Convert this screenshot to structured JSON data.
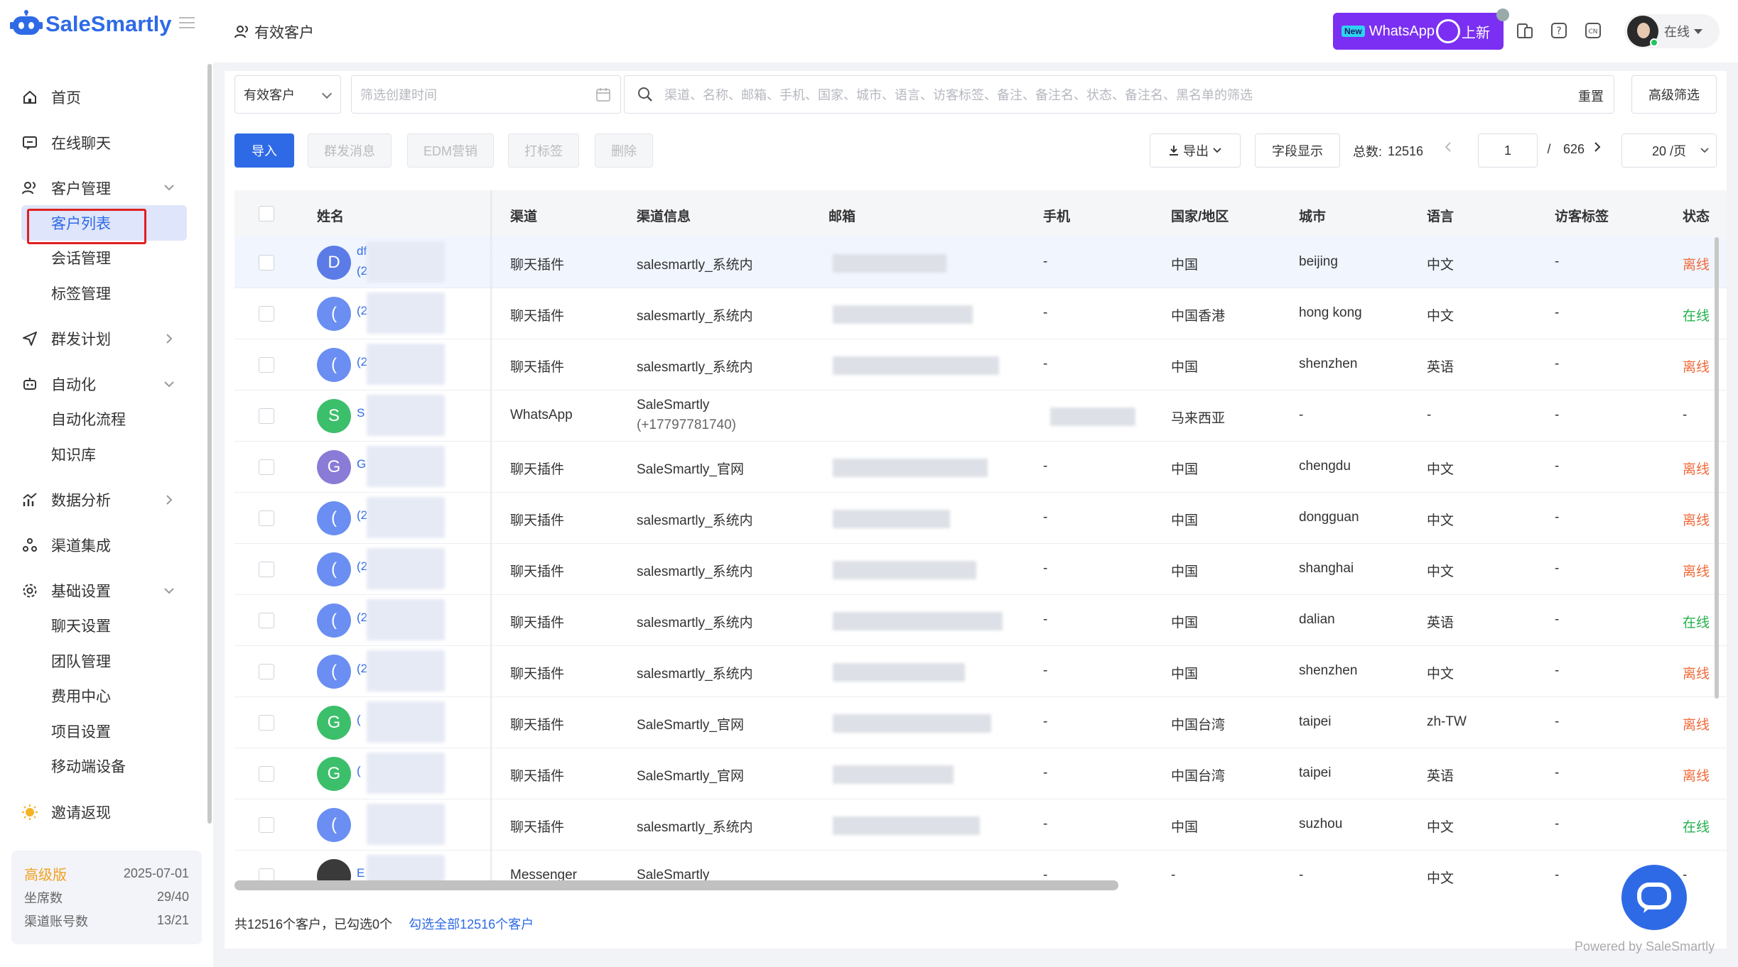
{
  "brand": {
    "name": "SaleSmartly"
  },
  "nav": {
    "home": "首页",
    "chat": "在线聊天",
    "customer_mgmt": "客户管理",
    "customer_list": "客户列表",
    "session_mgmt": "会话管理",
    "tag_mgmt": "标签管理",
    "broadcast": "群发计划",
    "automation": "自动化",
    "automation_flow": "自动化流程",
    "knowledge": "知识库",
    "analytics": "数据分析",
    "channels": "渠道集成",
    "basic_settings": "基础设置",
    "chat_settings": "聊天设置",
    "team_mgmt": "团队管理",
    "billing": "费用中心",
    "project_settings": "项目设置",
    "mobile_devices": "移动端设备",
    "invite": "邀请返现"
  },
  "plan": {
    "name": "高级版",
    "expiry": "2025-07-01",
    "seats_label": "坐席数",
    "seats_value": "29/40",
    "channels_label": "渠道账号数",
    "channels_value": "13/21"
  },
  "header": {
    "title": "有效客户",
    "banner_new": "New",
    "banner_text": "WhatsApp",
    "banner_suffix": "上新",
    "user_status": "在线",
    "cn_icon": "CN"
  },
  "filters": {
    "customer_type": "有效客户",
    "date_placeholder": "筛选创建时间",
    "search_placeholder": "渠道、名称、邮箱、手机、国家、城市、语言、访客标签、备注、备注名、状态、备注名、黑名单的筛选",
    "reset": "重置",
    "advanced": "高级筛选"
  },
  "toolbar": {
    "import": "导入",
    "broadcast": "群发消息",
    "edm": "EDM营销",
    "tag": "打标签",
    "delete": "删除",
    "export": "导出",
    "fields": "字段显示",
    "total_label": "总数:",
    "total": "12516",
    "page": "1",
    "slash": "/",
    "pages": "626",
    "page_size": "20 /页"
  },
  "table": {
    "headers": {
      "name": "姓名",
      "channel": "渠道",
      "channel_info": "渠道信息",
      "email": "邮箱",
      "phone": "手机",
      "country": "国家/地区",
      "city": "城市",
      "language": "语言",
      "visitor_tags": "访客标签",
      "status": "状态"
    },
    "rows": [
      {
        "initial": "D",
        "name": "df",
        "name2": "(2",
        "channel": "聊天插件",
        "info": "salesmartly_系统内",
        "info2": "",
        "phone": "-",
        "country": "中国",
        "city": "beijing",
        "lang": "中文",
        "tags": "-",
        "status": "离线"
      },
      {
        "initial": "(",
        "name": "(2",
        "name2": "",
        "channel": "聊天插件",
        "info": "salesmartly_系统内",
        "info2": "",
        "phone": "-",
        "country": "中国香港",
        "city": "hong kong",
        "lang": "中文",
        "tags": "-",
        "status": "在线"
      },
      {
        "initial": "(",
        "name": "(2",
        "name2": "",
        "channel": "聊天插件",
        "info": "salesmartly_系统内",
        "info2": "",
        "phone": "-",
        "country": "中国",
        "city": "shenzhen",
        "lang": "英语",
        "tags": "-",
        "status": "离线"
      },
      {
        "initial": "S",
        "name": "S",
        "name2": "",
        "channel": "WhatsApp",
        "info": "SaleSmartly",
        "info2": "(+17797781740)",
        "phone": "",
        "country": "马来西亚",
        "city": "-",
        "lang": "-",
        "tags": "-",
        "status": "-"
      },
      {
        "initial": "G",
        "name": "G",
        "name2": "",
        "channel": "聊天插件",
        "info": "SaleSmartly_官网",
        "info2": "",
        "phone": "-",
        "country": "中国",
        "city": "chengdu",
        "lang": "中文",
        "tags": "-",
        "status": "离线"
      },
      {
        "initial": "(",
        "name": "(2",
        "name2": "",
        "channel": "聊天插件",
        "info": "salesmartly_系统内",
        "info2": "",
        "phone": "-",
        "country": "中国",
        "city": "dongguan",
        "lang": "中文",
        "tags": "-",
        "status": "离线"
      },
      {
        "initial": "(",
        "name": "(2",
        "name2": "",
        "channel": "聊天插件",
        "info": "salesmartly_系统内",
        "info2": "",
        "phone": "-",
        "country": "中国",
        "city": "shanghai",
        "lang": "中文",
        "tags": "-",
        "status": "离线"
      },
      {
        "initial": "(",
        "name": "(2",
        "name2": "",
        "channel": "聊天插件",
        "info": "salesmartly_系统内",
        "info2": "",
        "phone": "-",
        "country": "中国",
        "city": "dalian",
        "lang": "英语",
        "tags": "-",
        "status": "在线"
      },
      {
        "initial": "(",
        "name": "(2",
        "name2": "",
        "channel": "聊天插件",
        "info": "salesmartly_系统内",
        "info2": "",
        "phone": "-",
        "country": "中国",
        "city": "shenzhen",
        "lang": "中文",
        "tags": "-",
        "status": "离线"
      },
      {
        "initial": "G",
        "name": "(",
        "name2": "",
        "channel": "聊天插件",
        "info": "SaleSmartly_官网",
        "info2": "",
        "phone": "-",
        "country": "中国台湾",
        "city": "taipei",
        "lang": "zh-TW",
        "tags": "-",
        "status": "离线"
      },
      {
        "initial": "G",
        "name": "(",
        "name2": "",
        "channel": "聊天插件",
        "info": "SaleSmartly_官网",
        "info2": "",
        "phone": "-",
        "country": "中国台湾",
        "city": "taipei",
        "lang": "英语",
        "tags": "-",
        "status": "离线"
      },
      {
        "initial": "(",
        "name": "",
        "name2": "",
        "channel": "聊天插件",
        "info": "salesmartly_系统内",
        "info2": "",
        "phone": "-",
        "country": "中国",
        "city": "suzhou",
        "lang": "中文",
        "tags": "-",
        "status": "在线"
      },
      {
        "initial": "",
        "name": "E",
        "name2": "",
        "channel": "Messenger",
        "info": "SaleSmartly",
        "info2": "",
        "phone": "-",
        "country": "-",
        "city": "-",
        "lang": "中文",
        "tags": "-",
        "status": "-"
      }
    ]
  },
  "footer": {
    "summary": "共12516个客户，已勾选0个",
    "select_all": "勾选全部12516个客户",
    "powered": "Powered by SaleSmartly"
  },
  "colors": {
    "accent": "#2f6ae6",
    "offline": "#f06a3a",
    "online": "#22b14c",
    "premium": "#f0a020"
  }
}
